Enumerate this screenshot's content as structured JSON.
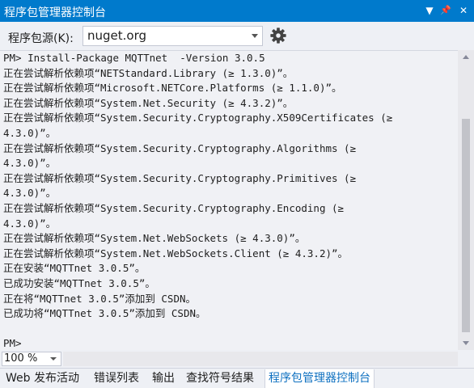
{
  "window": {
    "title": "程序包管理器控制台",
    "dropdown_glyph": "▼",
    "pin_glyph": "📌",
    "close_glyph": "✕"
  },
  "toolbar": {
    "source_label": "程序包源(K):",
    "source_value": "nuget.org"
  },
  "console": {
    "lines": [
      "PM> Install-Package MQTTnet  -Version 3.0.5",
      "正在尝试解析依赖项“NETStandard.Library (≥ 1.3.0)”。",
      "正在尝试解析依赖项“Microsoft.NETCore.Platforms (≥ 1.1.0)”。",
      "正在尝试解析依赖项“System.Net.Security (≥ 4.3.2)”。",
      "正在尝试解析依赖项“System.Security.Cryptography.X509Certificates (≥",
      "4.3.0)”。",
      "正在尝试解析依赖项“System.Security.Cryptography.Algorithms (≥",
      "4.3.0)”。",
      "正在尝试解析依赖项“System.Security.Cryptography.Primitives (≥",
      "4.3.0)”。",
      "正在尝试解析依赖项“System.Security.Cryptography.Encoding (≥",
      "4.3.0)”。",
      "正在尝试解析依赖项“System.Net.WebSockets (≥ 4.3.0)”。",
      "正在尝试解析依赖项“System.Net.WebSockets.Client (≥ 4.3.2)”。",
      "正在安装“MQTTnet 3.0.5”。",
      "已成功安装“MQTTnet 3.0.5”。",
      "正在将“MQTTnet 3.0.5”添加到 CSDN。",
      "已成功将“MQTTnet 3.0.5”添加到 CSDN。",
      "",
      "PM>"
    ]
  },
  "zoom": {
    "value": "100 %"
  },
  "tabs": [
    {
      "label": "Web 发布活动"
    },
    {
      "label": "错误列表"
    },
    {
      "label": "输出"
    },
    {
      "label": "查找符号结果"
    },
    {
      "label": "程序包管理器控制台"
    }
  ]
}
